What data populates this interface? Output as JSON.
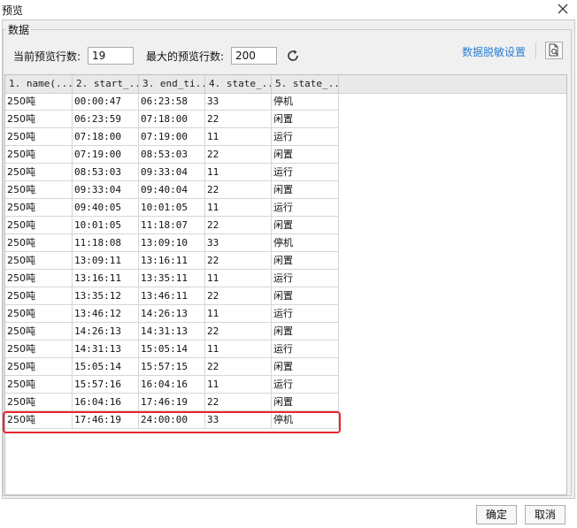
{
  "window": {
    "title": "预览"
  },
  "group": {
    "legend": "数据"
  },
  "controls": {
    "current_rows_label": "当前预览行数:",
    "current_rows_value": "19",
    "max_rows_label": "最大的预览行数:",
    "max_rows_value": "200",
    "desensitize_link": "数据脱敏设置"
  },
  "table": {
    "columns": [
      "1. name(...",
      "2. start_...",
      "3. end_ti...",
      "4. state_...",
      "5. state_..."
    ],
    "rows": [
      [
        "250吨",
        "00:00:47",
        "06:23:58",
        "33",
        "停机"
      ],
      [
        "250吨",
        "06:23:59",
        "07:18:00",
        "22",
        "闲置"
      ],
      [
        "250吨",
        "07:18:00",
        "07:19:00",
        "11",
        "运行"
      ],
      [
        "250吨",
        "07:19:00",
        "08:53:03",
        "22",
        "闲置"
      ],
      [
        "250吨",
        "08:53:03",
        "09:33:04",
        "11",
        "运行"
      ],
      [
        "250吨",
        "09:33:04",
        "09:40:04",
        "22",
        "闲置"
      ],
      [
        "250吨",
        "09:40:05",
        "10:01:05",
        "11",
        "运行"
      ],
      [
        "250吨",
        "10:01:05",
        "11:18:07",
        "22",
        "闲置"
      ],
      [
        "250吨",
        "11:18:08",
        "13:09:10",
        "33",
        "停机"
      ],
      [
        "250吨",
        "13:09:11",
        "13:16:11",
        "22",
        "闲置"
      ],
      [
        "250吨",
        "13:16:11",
        "13:35:11",
        "11",
        "运行"
      ],
      [
        "250吨",
        "13:35:12",
        "13:46:11",
        "22",
        "闲置"
      ],
      [
        "250吨",
        "13:46:12",
        "14:26:13",
        "11",
        "运行"
      ],
      [
        "250吨",
        "14:26:13",
        "14:31:13",
        "22",
        "闲置"
      ],
      [
        "250吨",
        "14:31:13",
        "15:05:14",
        "11",
        "运行"
      ],
      [
        "250吨",
        "15:05:14",
        "15:57:15",
        "22",
        "闲置"
      ],
      [
        "250吨",
        "15:57:16",
        "16:04:16",
        "11",
        "运行"
      ],
      [
        "250吨",
        "16:04:16",
        "17:46:19",
        "22",
        "闲置"
      ],
      [
        "250吨",
        "17:46:19",
        "24:00:00",
        "33",
        "停机"
      ]
    ]
  },
  "buttons": {
    "ok": "确定",
    "cancel": "取消"
  },
  "colors": {
    "highlight": "#e8262d",
    "link": "#2a7fd4"
  }
}
